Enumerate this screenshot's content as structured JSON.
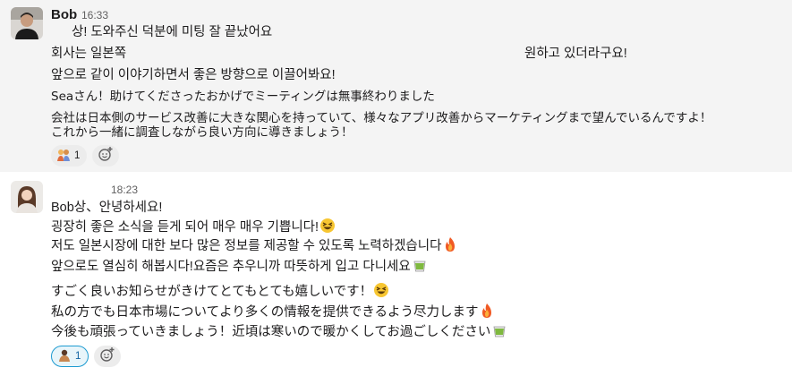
{
  "messages": [
    {
      "sender": "Bob",
      "time": "16:33",
      "lines": [
        "상! 도와주신 덕분에 미팅 잘 끝났어요",
        "회사는 일본쪽",
        "앞으로 같이 이야기하면서 좋은 방향으로 이끌어봐요!",
        "Seaさん！助けてくださったおかげでミーティングは無事終わりました",
        "会社は日本側のサービス改善に大きな関心を持っていて、様々なアプリ改善からマーケティングまで望んでいるんですよ！",
        "これから一緒に調査しながら良い方向に導きましょう！"
      ],
      "right_text": "원하고 있더라구요!",
      "reactions": [
        {
          "icon": "people-hugging-emoji",
          "count": "1"
        }
      ]
    },
    {
      "sender": "",
      "time": "18:23",
      "lines": [
        "Bob상、안녕하세요!",
        "굉장히 좋은 소식을 듣게 되어 매우 매우 기쁩니다!",
        "저도 일본시장에 대한 보다 많은 정보를 제공할 수 있도록 노력하겠습니다",
        "앞으로도 열심히 해봅시다!요즘은 추우니까 따뜻하게 입고 다니세요",
        "すごく良いお知らせがきけてとてもとても嬉しいです！",
        "私の方でも日本市場についてより多くの情報を提供できるよう尽力します",
        "今後も頑張っていきましょう！近頃は寒いので暖かくしてお過ごしください"
      ],
      "reactions": [
        {
          "icon": "person-bowing-emoji",
          "count": "1"
        }
      ]
    }
  ],
  "colors": {
    "message_hover_bg": "#f4f4f4",
    "reaction_active_border": "#1d9bd1",
    "reaction_active_bg": "#e8f5fa",
    "time_text": "#616061"
  }
}
